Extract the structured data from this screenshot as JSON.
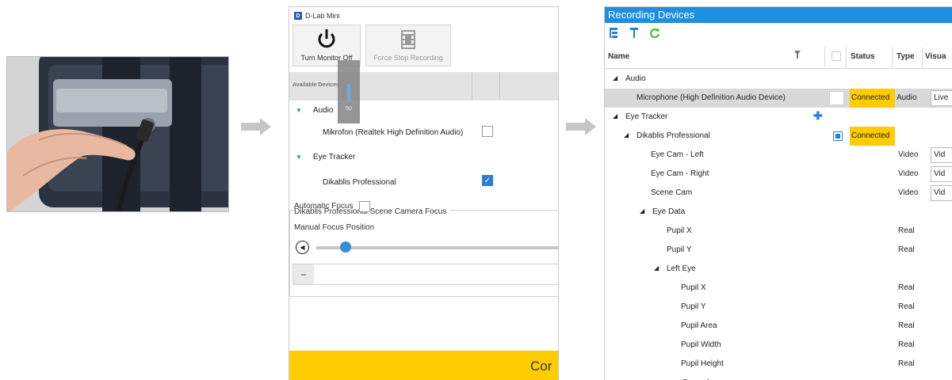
{
  "mini": {
    "title": "D-Lab Mini",
    "app_icon": "D",
    "toolbar": {
      "monitor_label": "Turn Monitor Off",
      "force_stop_label": "Force Stop Recording"
    },
    "devices_header": "Available Devices",
    "volume_value": "50",
    "tree": {
      "audio": "Audio",
      "mic": "Mikrofon (Realtek High Definition Audio)",
      "eye_tracker": "Eye Tracker",
      "dikablis": "Dikablis Professional"
    },
    "focus": {
      "title": "Dikablis Professional Scene Camera Focus",
      "automatic": "Automatic Focus",
      "manual": "Manual Focus Position",
      "minus": "–"
    },
    "connect_label": "Cor"
  },
  "rec": {
    "title": "Recording Devices",
    "headers": {
      "name": "Name",
      "status": "Status",
      "type": "Type",
      "visual": "Visua"
    },
    "rows": [
      {
        "label": "Audio",
        "indent": 10,
        "tri": "◢"
      },
      {
        "label": "Microphone (High Definition Audio Device)",
        "indent": 40,
        "status": "Connected",
        "type": "Audio",
        "visual": "Live",
        "selected": true,
        "check": "big"
      },
      {
        "label": "Eye Tracker",
        "indent": 10,
        "tri": "◢",
        "plus": true
      },
      {
        "label": "Dikablis Professional",
        "indent": 24,
        "tri": "◢",
        "status": "Connected",
        "check": "on"
      },
      {
        "label": "Eye Cam - Left",
        "indent": 58,
        "type": "Video",
        "visual": "Vid"
      },
      {
        "label": "Eye Cam - Right",
        "indent": 58,
        "type": "Video",
        "visual": "Vid"
      },
      {
        "label": "Scene Cam",
        "indent": 58,
        "type": "Video",
        "visual": "Vid"
      },
      {
        "label": "Eye Data",
        "indent": 44,
        "tri": "◢"
      },
      {
        "label": "Pupil X",
        "indent": 78,
        "type": "Real"
      },
      {
        "label": "Pupil Y",
        "indent": 78,
        "type": "Real"
      },
      {
        "label": "Left Eye",
        "indent": 62,
        "tri": "◢"
      },
      {
        "label": "Pupil X",
        "indent": 96,
        "type": "Real"
      },
      {
        "label": "Pupil Y",
        "indent": 96,
        "type": "Real"
      },
      {
        "label": "Pupil Area",
        "indent": 96,
        "type": "Real"
      },
      {
        "label": "Pupil Width",
        "indent": 96,
        "type": "Real"
      },
      {
        "label": "Pupil Height",
        "indent": 96,
        "type": "Real"
      },
      {
        "label": "Saccades",
        "indent": 82,
        "tri": "◢"
      }
    ]
  },
  "colors": {
    "accent_blue": "#1e8ee0",
    "connected_yellow": "#ffcc00",
    "selected_row": "#d9d9d9"
  },
  "icons": [
    "power-icon",
    "film-icon",
    "expand-all-icon",
    "collapse-all-icon",
    "refresh-icon",
    "filter-icon",
    "plus-icon",
    "checkmark-icon",
    "play-back-icon"
  ]
}
